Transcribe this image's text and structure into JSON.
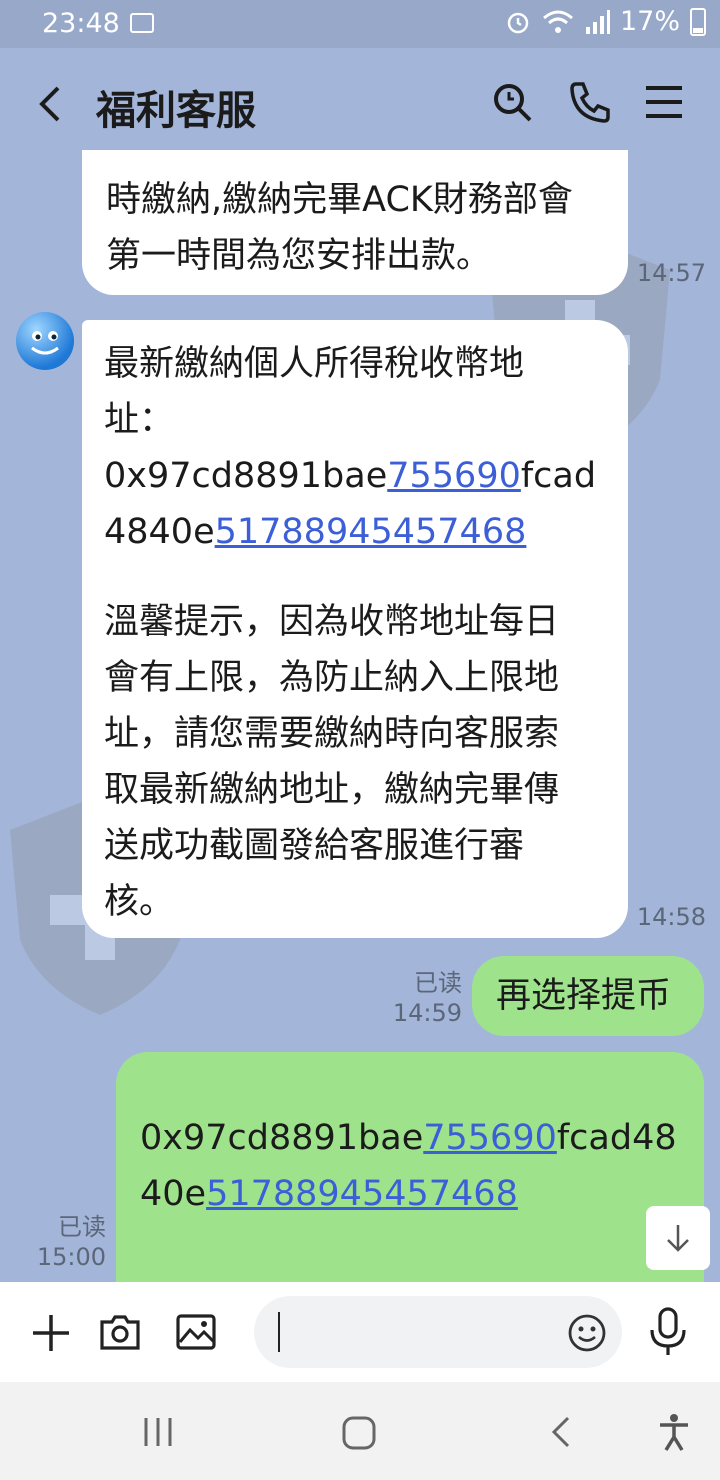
{
  "status_bar": {
    "time": "23:48",
    "battery": "17%"
  },
  "header": {
    "title": "福利客服",
    "icons": [
      "back-icon",
      "search-icon",
      "phone-icon",
      "menu-icon"
    ]
  },
  "messages": [
    {
      "side": "left",
      "lines": [
        "時繳納,繳納完畢ACK財務部會",
        "第一時間為您安排出款。"
      ],
      "time": "14:57"
    },
    {
      "side": "left",
      "line1": "最新繳納個人所得稅收幣地",
      "line2": "址：",
      "addr_a": "0x97cd8891bae",
      "addr_b": "755690",
      "addr_c": "fcad",
      "addr_d": "4840e",
      "addr_e": "51788945457468",
      "tip_lines": [
        "溫馨提示，因為收幣地址每日",
        "會有上限，為防止納入上限地",
        "址，請您需要繳納時向客服索",
        "取最新繳納地址，繳納完畢傳",
        "送成功截圖發給客服進行審",
        "核。"
      ],
      "time": "14:58"
    },
    {
      "side": "right",
      "text": "再选择提币",
      "read": "已读",
      "time": "14:59"
    },
    {
      "side": "right",
      "addr_a": "0x97cd8891bae",
      "addr_b": "755690",
      "addr_c": "fcad48",
      "addr_d": "40e",
      "addr_e": "51788945457468",
      "read": "已读",
      "time": "15:00"
    }
  ],
  "colors": {
    "background": "#a3b5d9",
    "sent_bubble": "#9ee38c",
    "received_bubble": "#ffffff",
    "link": "#3c5fd8"
  }
}
